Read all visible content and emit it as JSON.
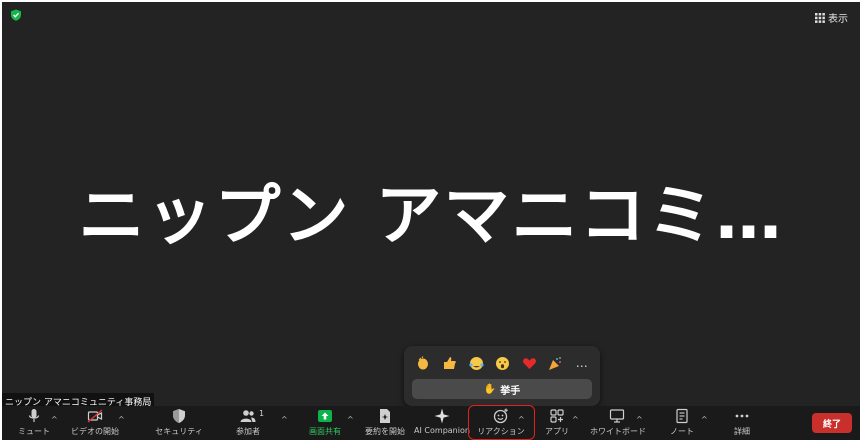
{
  "view_button": {
    "label": "表示"
  },
  "main_display_name": "ニップン アマニコミ…",
  "participant_name_tag": "ニップン アマニコミュニティ事務局",
  "reactions_popup": {
    "emojis": [
      "clap",
      "thumbs-up",
      "tears-of-joy",
      "open-mouth",
      "red-heart",
      "party-popper"
    ],
    "more_symbol": "…",
    "raise_hand_icon": "✋",
    "raise_hand_label": "挙手"
  },
  "toolbar": {
    "mute": "ミュート",
    "video": "ビデオの開始",
    "security": "セキュリティ",
    "participants": "参加者",
    "participant_count": "1",
    "share": "画面共有",
    "summary": "要約を開始",
    "ai": "AI Companion",
    "reactions": "リアクション",
    "apps": "アプリ",
    "whiteboard": "ホワイトボード",
    "notes": "ノート",
    "more": "詳細",
    "end": "終了"
  },
  "colors": {
    "background": "#232323",
    "toolbar": "#1a1a1a",
    "end_button": "#c9302c",
    "share_green": "#0bb34a",
    "highlight_red": "#e0231e"
  }
}
